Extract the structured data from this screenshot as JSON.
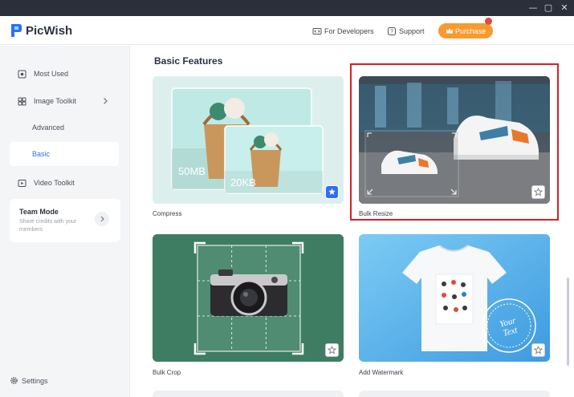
{
  "app": {
    "name": "PicWish",
    "header_links": {
      "developers": "For Developers",
      "support": "Support",
      "purchase": "Purchase"
    }
  },
  "sidebar": {
    "most_used": "Most Used",
    "image_toolkit": "Image Toolkit",
    "advanced": "Advanced",
    "basic": "Basic",
    "video_toolkit": "Video Toolkit",
    "team_mode": {
      "title": "Team Mode",
      "description": "Share credits with your members"
    },
    "settings": "Settings"
  },
  "main": {
    "section_title": "Basic Features",
    "cards": [
      {
        "label": "Compress",
        "badges": [
          "50MB",
          "20KB"
        ],
        "favorited": true
      },
      {
        "label": "Bulk Resize",
        "favorited": false,
        "highlighted": true
      },
      {
        "label": "Bulk Crop",
        "favorited": false
      },
      {
        "label": "Add Watermark",
        "watermark_text": "Your Text",
        "favorited": false
      }
    ]
  },
  "colors": {
    "accent": "#2f6df6",
    "purchase": "#f89a2e",
    "highlight_border": "#d92027",
    "titlebar": "#2b2f3a"
  }
}
